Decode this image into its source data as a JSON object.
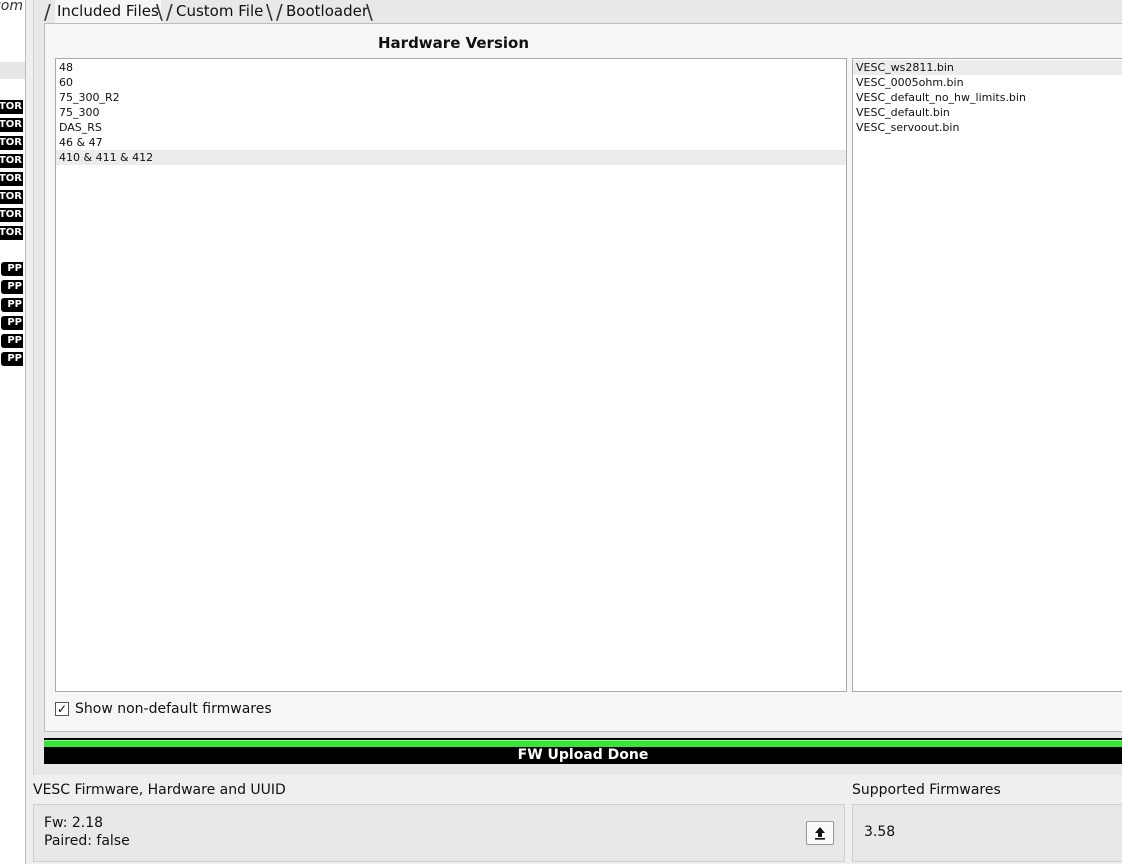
{
  "sidebar": {
    "top_text": "com",
    "badges": [
      "TOR",
      "TOR",
      "TOR",
      "TOR",
      "TOR",
      "TOR",
      "TOR",
      "TOR",
      "PP",
      "PP",
      "PP",
      "PP",
      "PP",
      "PP"
    ]
  },
  "tabs": [
    {
      "label": "Included Files"
    },
    {
      "label": "Custom File"
    },
    {
      "label": "Bootloader"
    }
  ],
  "hardware_title": "Hardware Version",
  "hardware_versions": [
    "48",
    "60",
    "75_300_R2",
    "75_300",
    "DAS_RS",
    "46 & 47",
    "410 & 411 & 412"
  ],
  "firmware_files": [
    "VESC_ws2811.bin",
    "VESC_0005ohm.bin",
    "VESC_default_no_hw_limits.bin",
    "VESC_default.bin",
    "VESC_servoout.bin"
  ],
  "show_non_default": {
    "label": "Show non-default firmwares",
    "checked": true,
    "mark": "✓"
  },
  "progress": {
    "text": "FW Upload Done",
    "fraction": 1.0
  },
  "info_section": {
    "label": "VESC Firmware, Hardware and UUID",
    "fw": "Fw: 2.18",
    "paired": "Paired: false"
  },
  "supported_section": {
    "label": "Supported Firmwares",
    "value": "3.58"
  },
  "icons": {
    "upload": "upload-icon"
  }
}
